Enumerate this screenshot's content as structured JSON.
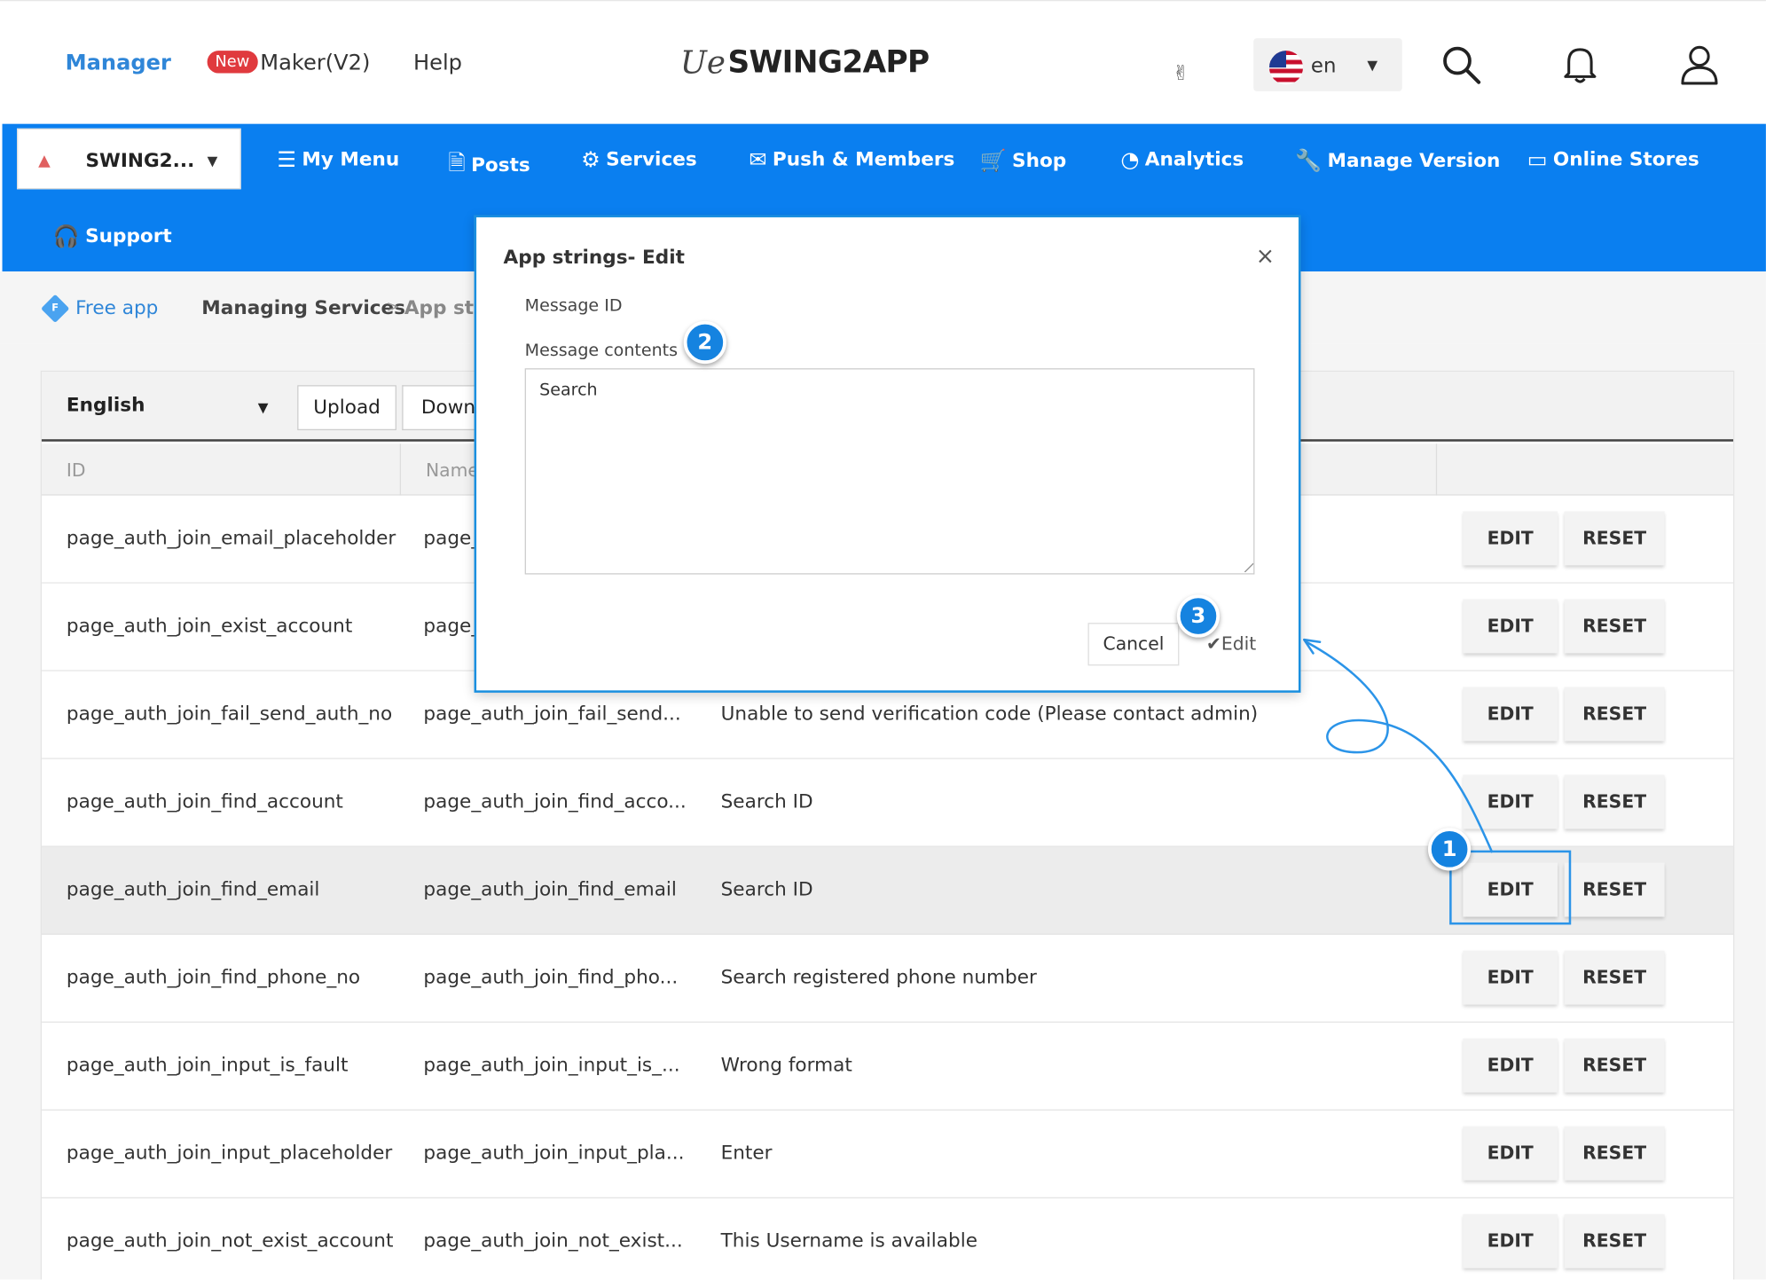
{
  "header": {
    "manager": "Manager",
    "new_badge": "New",
    "maker": "Maker(V2)",
    "help": "Help",
    "logo_text": "SWING2APP",
    "logo_script": "Ue",
    "peace_icon": "✌",
    "language": {
      "code": "en",
      "flag": "us-flag"
    }
  },
  "nav": {
    "app_name": "SWING2...",
    "items": [
      {
        "label": "My Menu",
        "icon": "menu-icon"
      },
      {
        "label": "Posts",
        "icon": "document-icon"
      },
      {
        "label": "Services",
        "icon": "gear-icon"
      },
      {
        "label": "Push & Members",
        "icon": "mail-icon"
      },
      {
        "label": "Shop",
        "icon": "cart-icon"
      },
      {
        "label": "Analytics",
        "icon": "pie-icon"
      },
      {
        "label": "Manage Version",
        "icon": "wrench-icon"
      },
      {
        "label": "Online Stores",
        "icon": "card-icon"
      },
      {
        "label": "Support",
        "icon": "headset-icon"
      }
    ]
  },
  "breadcrumb": {
    "badge": "F",
    "free_app": "Free app",
    "managing": "Managing Services",
    "separator": ">",
    "current": "App str"
  },
  "toolbar": {
    "language": "English",
    "upload": "Upload",
    "download": "Downl"
  },
  "table": {
    "headers": {
      "id": "ID",
      "name": "Name"
    },
    "edit_label": "EDIT",
    "reset_label": "RESET",
    "rows": [
      {
        "id": "page_auth_join_email_placeholder",
        "name": "page_",
        "value": ""
      },
      {
        "id": "page_auth_join_exist_account",
        "name": "page_",
        "value": ""
      },
      {
        "id": "page_auth_join_fail_send_auth_no",
        "name": "page_auth_join_fail_send...",
        "value": "Unable to send verification code (Please contact admin)"
      },
      {
        "id": "page_auth_join_find_account",
        "name": "page_auth_join_find_acco...",
        "value": "Search ID"
      },
      {
        "id": "page_auth_join_find_email",
        "name": "page_auth_join_find_email",
        "value": "Search ID"
      },
      {
        "id": "page_auth_join_find_phone_no",
        "name": "page_auth_join_find_pho...",
        "value": "Search registered phone number"
      },
      {
        "id": "page_auth_join_input_is_fault",
        "name": "page_auth_join_input_is_...",
        "value": "Wrong format"
      },
      {
        "id": "page_auth_join_input_placeholder",
        "name": "page_auth_join_input_pla...",
        "value": "Enter"
      },
      {
        "id": "page_auth_join_not_exist_account",
        "name": "page_auth_join_not_exist...",
        "value": "This Username is available"
      }
    ]
  },
  "modal": {
    "title": "App strings- Edit",
    "close": "×",
    "message_id_label": "Message ID",
    "message_contents_label": "Message contents",
    "contents_value": "Search",
    "cancel": "Cancel",
    "edit": "✔Edit"
  },
  "steps": {
    "one": "1",
    "two": "2",
    "three": "3"
  },
  "colors": {
    "accent": "#0a7ff0",
    "brand_link": "#2f86d8",
    "new_badge": "#e03a3e",
    "step_badge": "#1583e0"
  }
}
